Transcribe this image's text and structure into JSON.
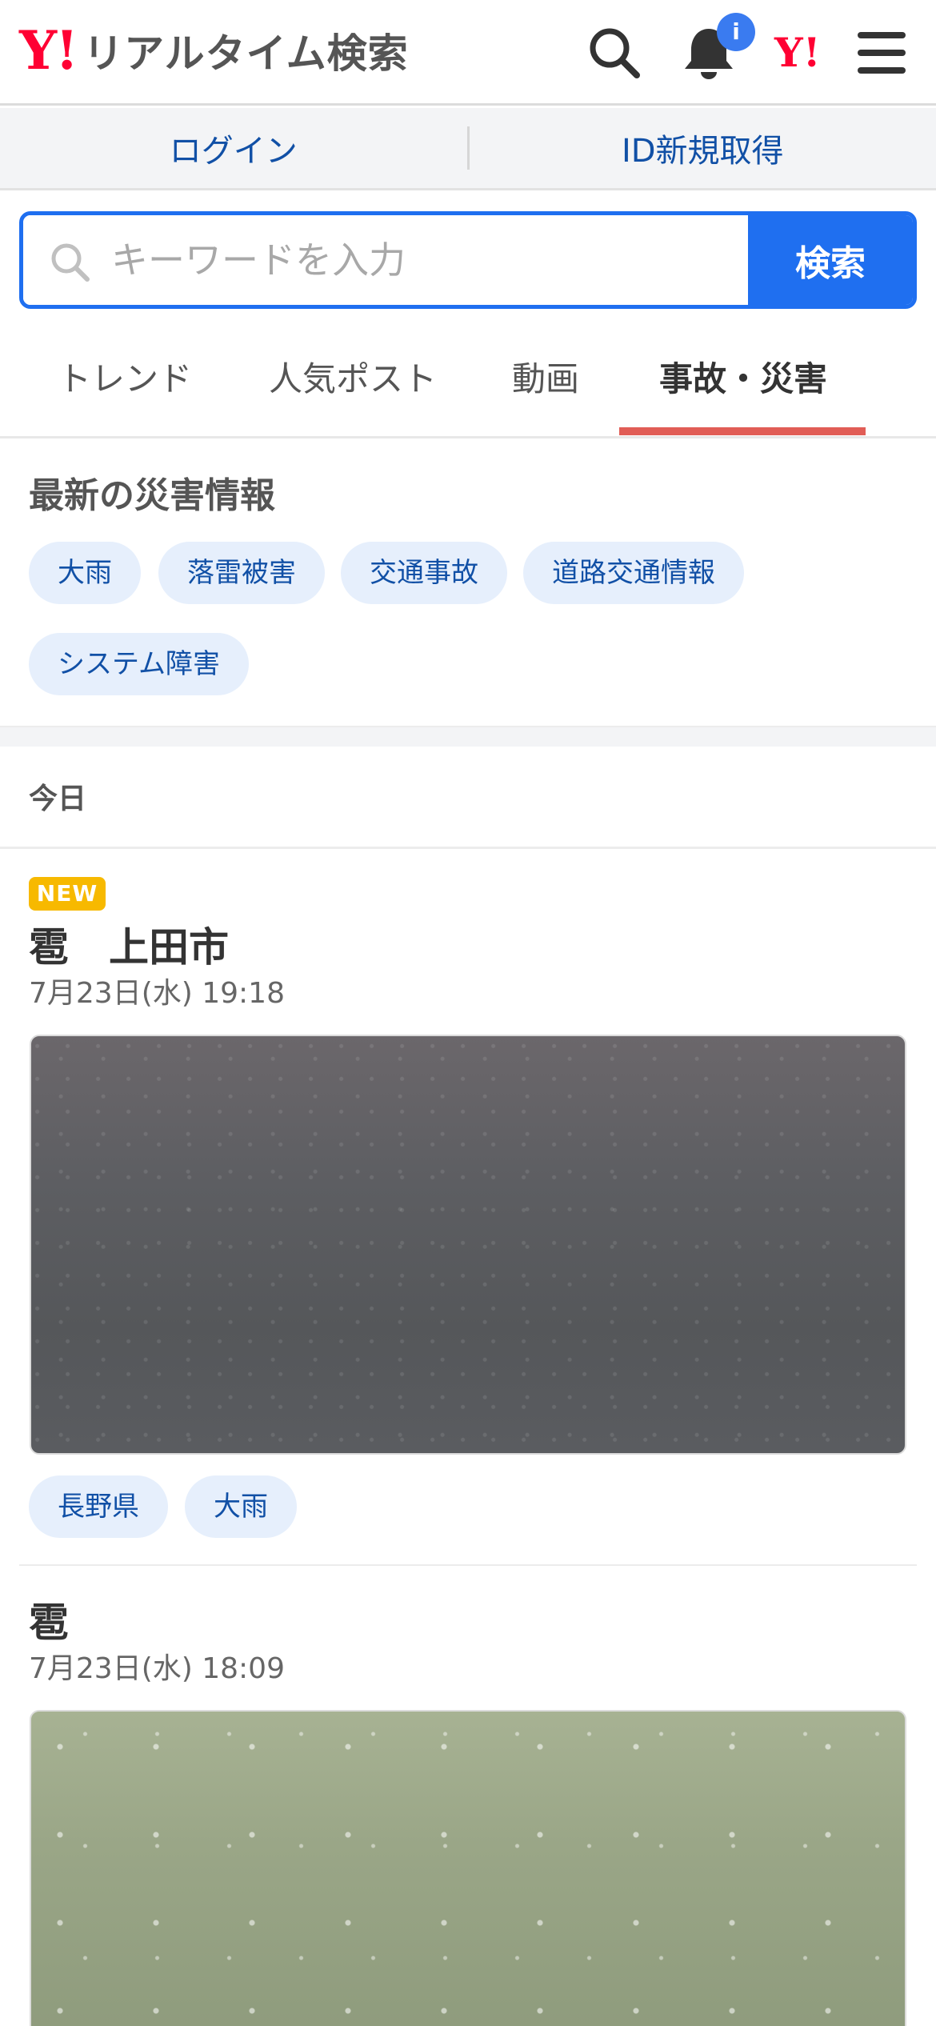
{
  "header": {
    "logo_mark": "Y!",
    "logo_text": "リアルタイム検索",
    "notification_badge": "i",
    "yahoo_mark": "Y!"
  },
  "account": {
    "login_label": "ログイン",
    "register_label": "ID新規取得"
  },
  "search": {
    "placeholder": "キーワードを入力",
    "button_label": "検索"
  },
  "tabs": [
    {
      "label": "トレンド",
      "active": false
    },
    {
      "label": "人気ポスト",
      "active": false
    },
    {
      "label": "動画",
      "active": false
    },
    {
      "label": "事故・災害",
      "active": true
    }
  ],
  "disaster": {
    "title": "最新の災害情報",
    "chips": [
      "大雨",
      "落雷被害",
      "交通事故",
      "道路交通情報",
      "システム障害"
    ]
  },
  "section_today": "今日",
  "posts": [
    {
      "badge": "NEW",
      "title": "雹　上田市",
      "date": "7月23日(水) 19:18",
      "tags": [
        "長野県",
        "大雨"
      ]
    },
    {
      "title": "雹",
      "date": "7月23日(水) 18:09"
    }
  ],
  "colors": {
    "brand_red": "#ff0033",
    "accent_blue": "#1f6ff0",
    "link_blue": "#1150a6",
    "tab_underline": "#e15d56",
    "new_badge": "#f7b900"
  }
}
